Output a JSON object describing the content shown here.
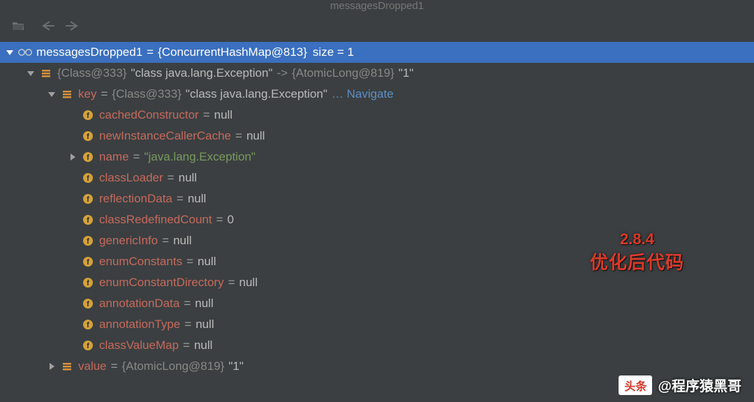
{
  "tab": {
    "title": "messagesDropped1"
  },
  "overlay": {
    "version": "2.8.4",
    "caption_zh": "优化后代码"
  },
  "byline": {
    "badge": "头条",
    "handle": "@程序猿黑哥"
  },
  "root": {
    "name": "messagesDropped1",
    "ref": "{ConcurrentHashMap@813}",
    "size_label": "size = 1"
  },
  "entry": {
    "keyRef": "{Class@333}",
    "keyStr": "\"class java.lang.Exception\"",
    "valRef": "{AtomicLong@819}",
    "valStr": "\"1\""
  },
  "key": {
    "name": "key",
    "ref": "{Class@333}",
    "str": "\"class java.lang.Exception\"",
    "navigate": "… Navigate"
  },
  "fields": [
    {
      "chev": "none",
      "name": "cachedConstructor",
      "value_plain": "null"
    },
    {
      "chev": "none",
      "name": "newInstanceCallerCache",
      "value_plain": "null"
    },
    {
      "chev": "closed",
      "name": "name",
      "value_str": "\"java.lang.Exception\""
    },
    {
      "chev": "none",
      "name": "classLoader",
      "value_plain": "null"
    },
    {
      "chev": "none",
      "name": "reflectionData",
      "value_plain": "null"
    },
    {
      "chev": "none",
      "name": "classRedefinedCount",
      "value_plain": "0"
    },
    {
      "chev": "none",
      "name": "genericInfo",
      "value_plain": "null"
    },
    {
      "chev": "none",
      "name": "enumConstants",
      "value_plain": "null"
    },
    {
      "chev": "none",
      "name": "enumConstantDirectory",
      "value_plain": "null"
    },
    {
      "chev": "none",
      "name": "annotationData",
      "value_plain": "null"
    },
    {
      "chev": "none",
      "name": "annotationType",
      "value_plain": "null"
    },
    {
      "chev": "none",
      "name": "classValueMap",
      "value_plain": "null"
    }
  ],
  "value": {
    "name": "value",
    "ref": "{AtomicLong@819}",
    "str": "\"1\""
  }
}
